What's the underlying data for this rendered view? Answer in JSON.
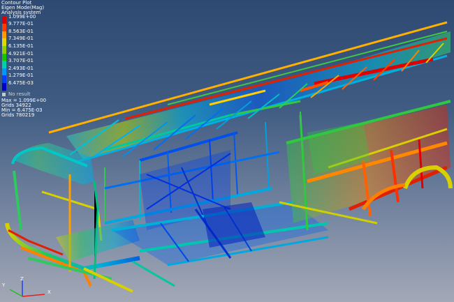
{
  "legend": {
    "title": "Contour Plot",
    "result_type": "Eigen Mode(Mag)",
    "system": "Analysis system",
    "bands": [
      {
        "label": "1.099E+00",
        "color": "#e00000"
      },
      {
        "label": "9.777E-01",
        "color": "#ff3c00"
      },
      {
        "label": "8.563E-01",
        "color": "#ff9a00"
      },
      {
        "label": "7.349E-01",
        "color": "#d8dc00"
      },
      {
        "label": "6.135E-01",
        "color": "#8ed000"
      },
      {
        "label": "4.921E-01",
        "color": "#10c800"
      },
      {
        "label": "3.707E-01",
        "color": "#00d2a8"
      },
      {
        "label": "2.493E-01",
        "color": "#0098ff"
      },
      {
        "label": "1.279E-01",
        "color": "#0040ff"
      },
      {
        "label": "6.475E-03",
        "color": "#0000c8"
      }
    ],
    "no_result": "No result",
    "max": "Max = 1.099E+00",
    "max_grids": "Grids 34922",
    "min": "Min = 6.475E-03",
    "min_grids": "Grids 780219"
  },
  "triad": {
    "x_label": "X",
    "y_label": "Y",
    "z_label": "Z"
  },
  "colors": {
    "background_top": "#2f4a72",
    "background_bottom": "#a3a8b6",
    "max_red": "#e00000",
    "min_blue": "#0000c8"
  }
}
